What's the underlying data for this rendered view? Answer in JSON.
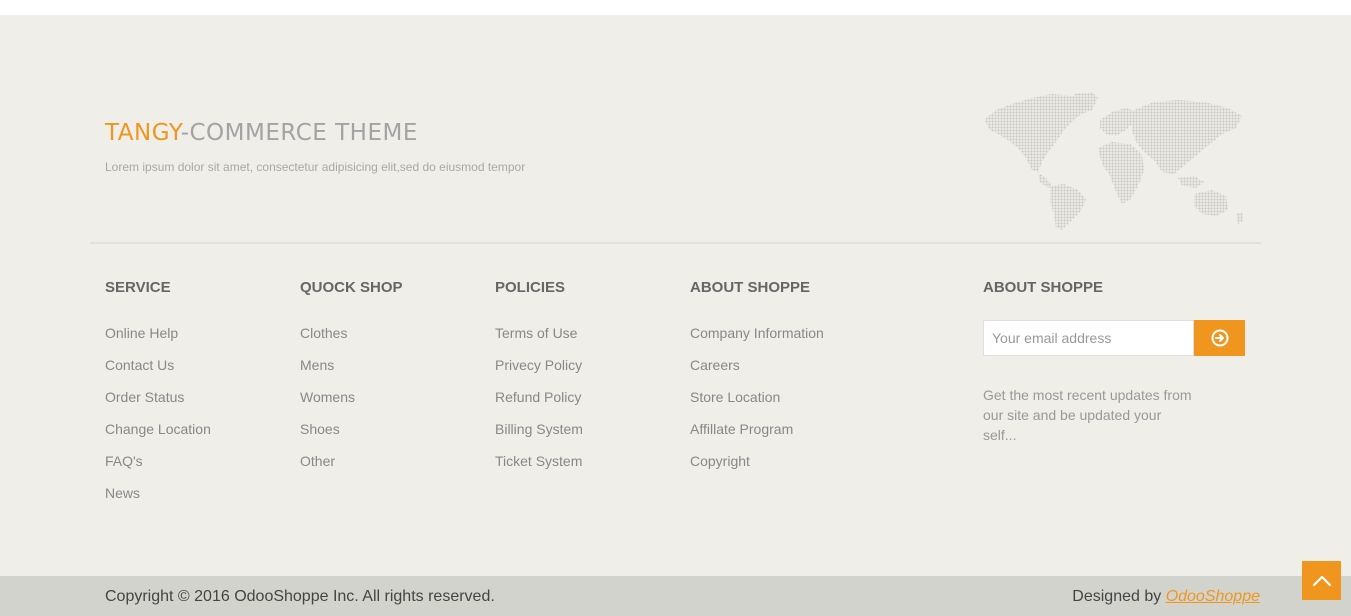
{
  "brand": {
    "title_accent": "TANGY",
    "title_rest": "-COMMERCE THEME",
    "tagline": "Lorem ipsum dolor sit amet, consectetur adipisicing elit,sed do eiusmod tempor"
  },
  "columns": [
    {
      "heading": "SERVICE",
      "links": [
        "Online Help",
        "Contact Us",
        "Order Status",
        "Change Location",
        "FAQ's",
        "News"
      ]
    },
    {
      "heading": "QUOCK SHOP",
      "links": [
        "Clothes",
        "Mens",
        "Womens",
        "Shoes",
        "Other"
      ]
    },
    {
      "heading": "POLICIES",
      "links": [
        "Terms of Use",
        "Privecy Policy",
        "Refund Policy",
        "Billing System",
        "Ticket System"
      ]
    },
    {
      "heading": "ABOUT SHOPPE",
      "links": [
        "Company Information",
        "Careers",
        "Store Location",
        "Affillate Program",
        "Copyright"
      ]
    }
  ],
  "newsletter": {
    "heading": "ABOUT SHOPPE",
    "placeholder": "Your email address",
    "button_icon": "arrow-circle-right-icon",
    "text": "Get the most recent updates from our site and be updated your self..."
  },
  "footer": {
    "copyright": "Copyright © 2016 OdooShoppe Inc. All rights reserved.",
    "designed_prefix": "Designed by ",
    "designed_link": "OdooShoppe"
  },
  "icons": {
    "map": "world-map-icon",
    "scroll_top": "chevron-up-icon"
  },
  "colors": {
    "accent": "#f0961e",
    "background": "#efeee9",
    "bottom_bar": "#d3d3ce"
  }
}
